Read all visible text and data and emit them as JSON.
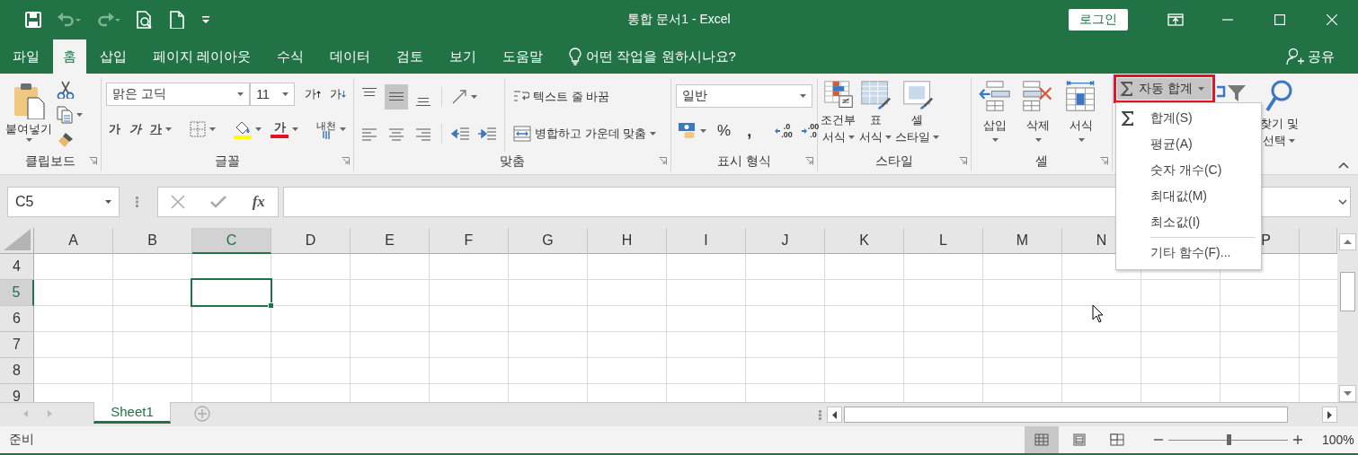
{
  "title_bar": {
    "quick_access": [
      {
        "kind": "save",
        "disabled": false
      },
      {
        "kind": "undo",
        "disabled": true
      },
      {
        "kind": "redo",
        "disabled": true
      },
      {
        "kind": "preview",
        "disabled": false
      },
      {
        "kind": "new",
        "disabled": false
      },
      {
        "kind": "customize",
        "disabled": false
      }
    ],
    "title": "통합 문서1  -  Excel",
    "login": "로그인"
  },
  "tabs": [
    {
      "label": "파일",
      "selected": false
    },
    {
      "label": "홈",
      "selected": true
    },
    {
      "label": "삽입",
      "selected": false
    },
    {
      "label": "페이지 레이아웃",
      "selected": false
    },
    {
      "label": "수식",
      "selected": false
    },
    {
      "label": "데이터",
      "selected": false
    },
    {
      "label": "검토",
      "selected": false
    },
    {
      "label": "보기",
      "selected": false
    },
    {
      "label": "도움말",
      "selected": false
    }
  ],
  "tell_me": "어떤 작업을 원하시나요?",
  "share": "공유",
  "ribbon": {
    "clipboard": {
      "paste": "붙여넣기",
      "label": "클립보드"
    },
    "font": {
      "name": "맑은 고딕",
      "size": "11",
      "grow": "가",
      "shrink": "가",
      "bold": "가",
      "italic": "가",
      "underline": "가",
      "font_color": "가",
      "phonetic": "내천",
      "label": "글꼴"
    },
    "alignment": {
      "vertical": [
        {
          "kind": "top",
          "selected": false
        },
        {
          "kind": "middle",
          "selected": true
        },
        {
          "kind": "bottom",
          "selected": false
        }
      ],
      "wrap": "텍스트 줄 바꿈",
      "merge": "병합하고 가운데 맞춤",
      "label": "맞춤"
    },
    "number": {
      "format": "일반",
      "percent": "%",
      "comma": ",",
      "increase_decimal": [
        ".0",
        ".00"
      ],
      "decrease_decimal": [
        ".00",
        ".0"
      ],
      "label": "표시 형식"
    },
    "styles": {
      "buttons": [
        {
          "kind": "conditional",
          "lines": [
            "조건부",
            "서식"
          ]
        },
        {
          "kind": "table",
          "lines": [
            "표",
            "서식"
          ]
        },
        {
          "kind": "cell",
          "lines": [
            "셀",
            "스타일"
          ]
        }
      ],
      "label": "스타일"
    },
    "cells": {
      "buttons": [
        {
          "kind": "insert",
          "label": "삽입"
        },
        {
          "kind": "delete",
          "label": "삭제"
        },
        {
          "kind": "format",
          "label": "서식"
        }
      ],
      "label": "셀"
    },
    "editing": {
      "autosum": "자동 합계",
      "find": [
        "찾기 및",
        "선택"
      ]
    }
  },
  "autosum_menu": [
    {
      "kind": "sum",
      "label": "합계(S)",
      "separator_before": false
    },
    {
      "kind": "plain",
      "label": "평균(A)",
      "separator_before": false
    },
    {
      "kind": "plain",
      "label": "숫자 개수(C)",
      "separator_before": false
    },
    {
      "kind": "plain",
      "label": "최대값(M)",
      "separator_before": false
    },
    {
      "kind": "plain",
      "label": "최소값(I)",
      "separator_before": false
    },
    {
      "kind": "plain",
      "label": "기타 함수(F)...",
      "separator_before": true
    }
  ],
  "formula_bar": {
    "name_box": "C5",
    "fx": "fx"
  },
  "grid": {
    "columns": [
      {
        "label": "A",
        "selected": false
      },
      {
        "label": "B",
        "selected": false
      },
      {
        "label": "C",
        "selected": true
      },
      {
        "label": "D",
        "selected": false
      },
      {
        "label": "E",
        "selected": false
      },
      {
        "label": "F",
        "selected": false
      },
      {
        "label": "G",
        "selected": false
      },
      {
        "label": "H",
        "selected": false
      },
      {
        "label": "I",
        "selected": false
      },
      {
        "label": "J",
        "selected": false
      },
      {
        "label": "K",
        "selected": false
      },
      {
        "label": "L",
        "selected": false
      },
      {
        "label": "M",
        "selected": false
      },
      {
        "label": "N",
        "selected": false
      },
      {
        "label": "P",
        "selected": false,
        "follows_covered": true
      }
    ],
    "rows": [
      {
        "label": "4",
        "selected": false
      },
      {
        "label": "5",
        "selected": true
      },
      {
        "label": "6",
        "selected": false
      },
      {
        "label": "7",
        "selected": false
      },
      {
        "label": "8",
        "selected": false
      },
      {
        "label": "9",
        "selected": false
      }
    ]
  },
  "sheets": [
    {
      "label": "Sheet1",
      "selected": true
    }
  ],
  "status": {
    "text": "준비",
    "views": [
      {
        "kind": "normal",
        "selected": true
      },
      {
        "kind": "page_layout",
        "selected": false
      },
      {
        "kind": "page_break",
        "selected": false
      }
    ],
    "zoom": {
      "level": 0.5,
      "reading": "100%"
    }
  }
}
